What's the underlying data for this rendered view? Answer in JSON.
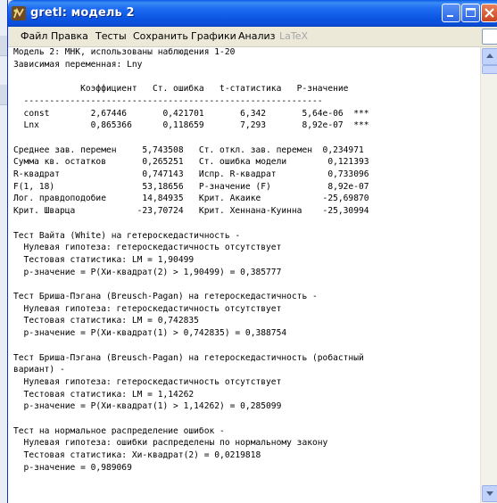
{
  "window": {
    "title": "gretl: модель 2"
  },
  "menu": [
    {
      "label": "Файл",
      "enabled": true
    },
    {
      "label": "Правка",
      "enabled": true
    },
    {
      "label": "Тесты",
      "enabled": true
    },
    {
      "label": "Сохранить",
      "enabled": true
    },
    {
      "label": "Графики",
      "enabled": true
    },
    {
      "label": "Анализ",
      "enabled": true
    },
    {
      "label": "LaTeX",
      "enabled": false
    }
  ],
  "output_lines": [
    "Модель 2: МНК, использованы наблюдения 1-20",
    "Зависимая переменная: Lny",
    "",
    "             Коэффициент   Ст. ошибка   t-статистика   P-значение",
    "  ----------------------------------------------------------",
    "  const        2,67446       0,421701       6,342       5,64e-06  ***",
    "  Lnx          0,865366      0,118659       7,293       8,92e-07  ***",
    "",
    "Среднее зав. перемен     5,743508   Ст. откл. зав. перемен  0,234971",
    "Сумма кв. остатков       0,265251   Ст. ошибка модели        0,121393",
    "R-квадрат                0,747143   Испр. R-квадрат          0,733096",
    "F(1, 18)                 53,18656   Р-значение (F)           8,92e-07",
    "Лог. правдоподобие       14,84935   Крит. Акаике            -25,69870",
    "Крит. Шварца            -23,70724   Крит. Хеннана-Куинна    -25,30994",
    "",
    "Тест Вайта (White) на гетероскедастичность -",
    "  Нулевая гипотеза: гетероскедастичность отсутствует",
    "  Тестовая статистика: LM = 1,90499",
    "  p-значение = P(Хи-квадрат(2) > 1,90499) = 0,385777",
    "",
    "Тест Бриша-Пэгана (Breusch-Pagan) на гетероскедастичность -",
    "  Нулевая гипотеза: гетероскедастичность отсутствует",
    "  Тестовая статистика: LM = 0,742835",
    "  p-значение = P(Хи-квадрат(1) > 0,742835) = 0,388754",
    "",
    "Тест Бриша-Пэгана (Breusch-Pagan) на гетероскедастичность (робастный",
    "вариант) -",
    "  Нулевая гипотеза: гетероскедастичность отсутствует",
    "  Тестовая статистика: LM = 1,14262",
    "  p-значение = P(Хи-квадрат(1) > 1,14262) = 0,285099",
    "",
    "Тест на нормальное распределение ошибок -",
    "  Нулевая гипотеза: ошибки распределены по нормальному закону",
    "  Тестовая статистика: Хи-квадрат(2) = 0,0219818",
    "  p-значение = 0,989069"
  ]
}
